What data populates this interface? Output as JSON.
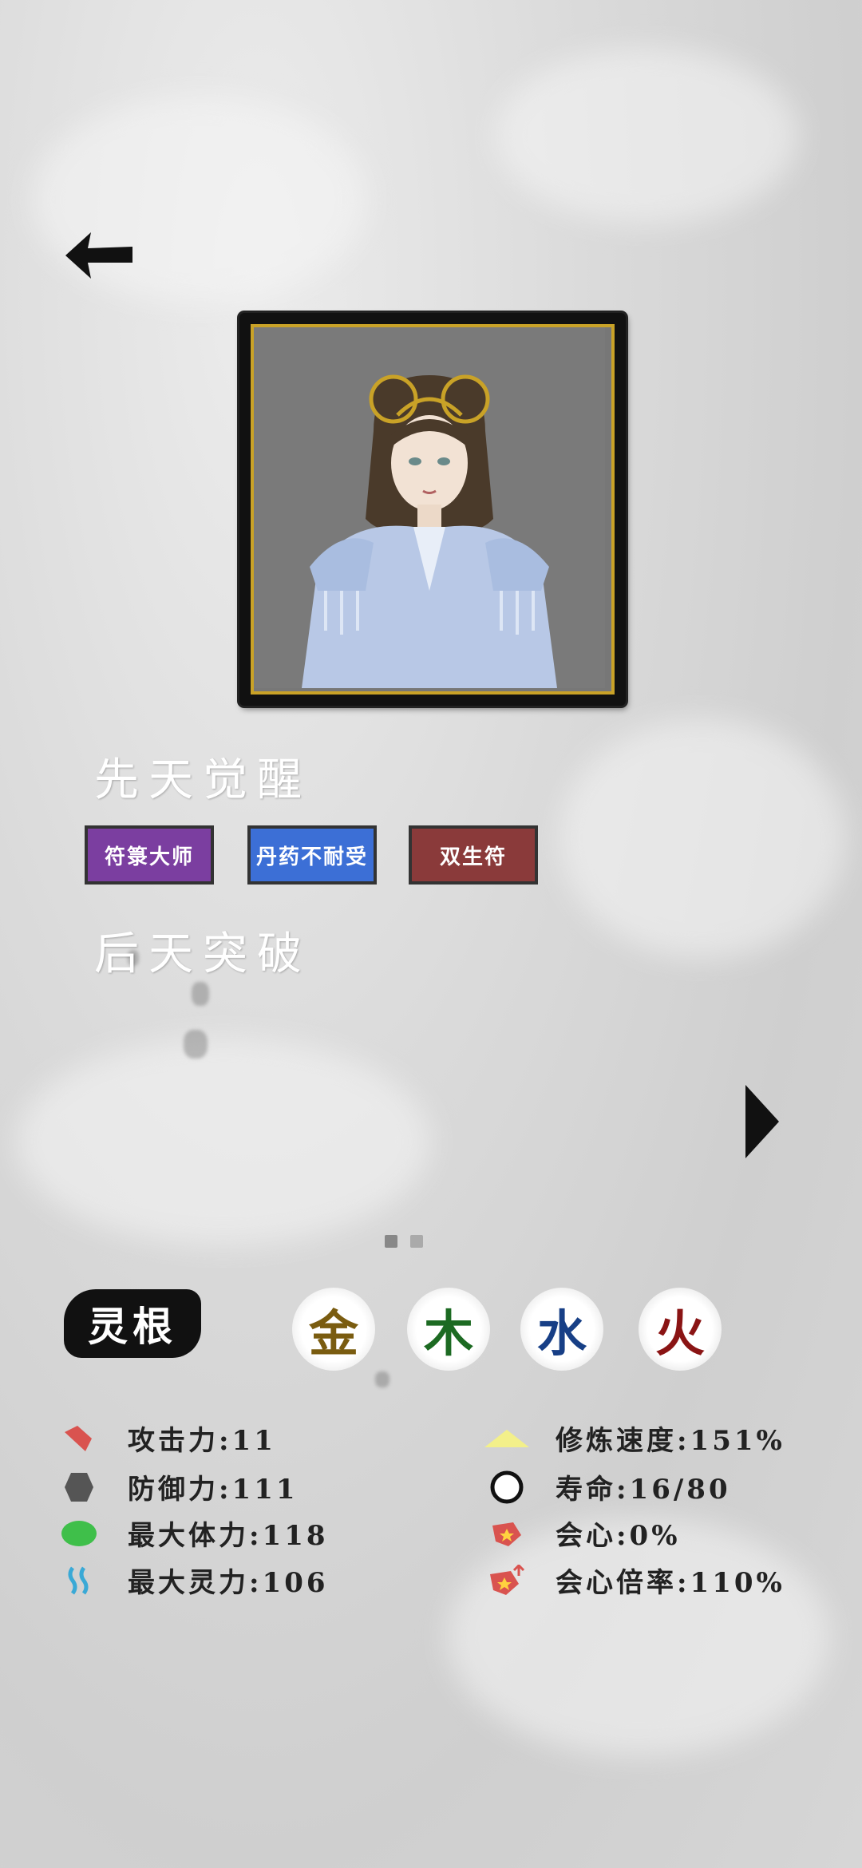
{
  "traits_title": "先天觉醒",
  "breakthrough_title": "后天突破",
  "traits": [
    {
      "label": "符箓大师",
      "color": "#7b3ea0"
    },
    {
      "label": "丹药不耐受",
      "color": "#3c6fd6"
    },
    {
      "label": "双生符",
      "color": "#8a3a3a"
    }
  ],
  "lingen": {
    "label": "灵根",
    "elements": [
      {
        "char": "金",
        "color": "#7a5c10"
      },
      {
        "char": "木",
        "color": "#1c6a22"
      },
      {
        "char": "水",
        "color": "#173f86"
      },
      {
        "char": "火",
        "color": "#8a1414"
      }
    ]
  },
  "stats_left": [
    {
      "label": "攻击力:11",
      "icon": "attack-icon"
    },
    {
      "label": "防御力:111",
      "icon": "defense-icon"
    },
    {
      "label": "最大体力:118",
      "icon": "health-icon"
    },
    {
      "label": "最大灵力:106",
      "icon": "spirit-icon"
    }
  ],
  "stats_right": [
    {
      "label": "修炼速度:151%",
      "icon": "cultivation-speed-icon"
    },
    {
      "label": "寿命:16/80",
      "icon": "lifespan-icon"
    },
    {
      "label": "会心:0%",
      "icon": "crit-icon"
    },
    {
      "label": "会心倍率:110%",
      "icon": "crit-multiplier-icon"
    }
  ],
  "pager": {
    "current": 1,
    "total": 2
  }
}
